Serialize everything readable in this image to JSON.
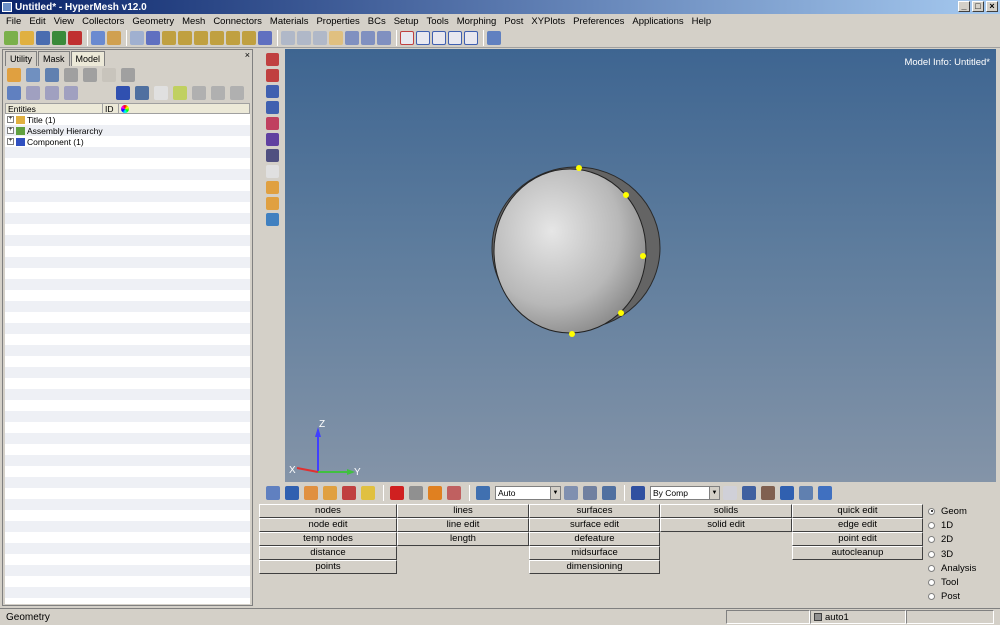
{
  "window": {
    "title": "Untitled* - HyperMesh v12.0"
  },
  "menu": [
    "File",
    "Edit",
    "View",
    "Collectors",
    "Geometry",
    "Mesh",
    "Connectors",
    "Materials",
    "Properties",
    "BCs",
    "Setup",
    "Tools",
    "Morphing",
    "Post",
    "XYPlots",
    "Preferences",
    "Applications",
    "Help"
  ],
  "left_panel": {
    "tabs": [
      "Utility",
      "Mask",
      "Model"
    ],
    "active_tab": "Model",
    "close": "×",
    "columns": [
      "Entities",
      "ID"
    ],
    "tree": [
      {
        "label": "Title (1)",
        "icon": "folder-icon"
      },
      {
        "label": "Assembly Hierarchy",
        "icon": "assembly-icon"
      },
      {
        "label": "Component (1)",
        "icon": "component-icon"
      }
    ]
  },
  "viewport": {
    "model_info": "Model Info: Untitled*",
    "axes": {
      "z": "Z",
      "x": "X",
      "y": "Y"
    }
  },
  "viewport_toolbar": {
    "auto_select": "Auto",
    "color_mode": "By Comp"
  },
  "panels": {
    "col1": [
      "nodes",
      "node edit",
      "temp nodes",
      "distance",
      "points"
    ],
    "col2": [
      "lines",
      "line edit",
      "length"
    ],
    "col3": [
      "surfaces",
      "surface edit",
      "defeature",
      "midsurface",
      "dimensioning"
    ],
    "col4": [
      "solids",
      "solid edit"
    ],
    "col5": [
      "quick edit",
      "edge edit",
      "point edit",
      "autocleanup"
    ]
  },
  "page_radios": {
    "options": [
      "Geom",
      "1D",
      "2D",
      "3D",
      "Analysis",
      "Tool",
      "Post"
    ],
    "selected": "Geom"
  },
  "status": {
    "text": "Geometry",
    "component": "auto1"
  },
  "colors": {
    "viewport_top": "#3e6591",
    "viewport_bottom": "#8494a8",
    "fixed_point": "#ffff00"
  }
}
